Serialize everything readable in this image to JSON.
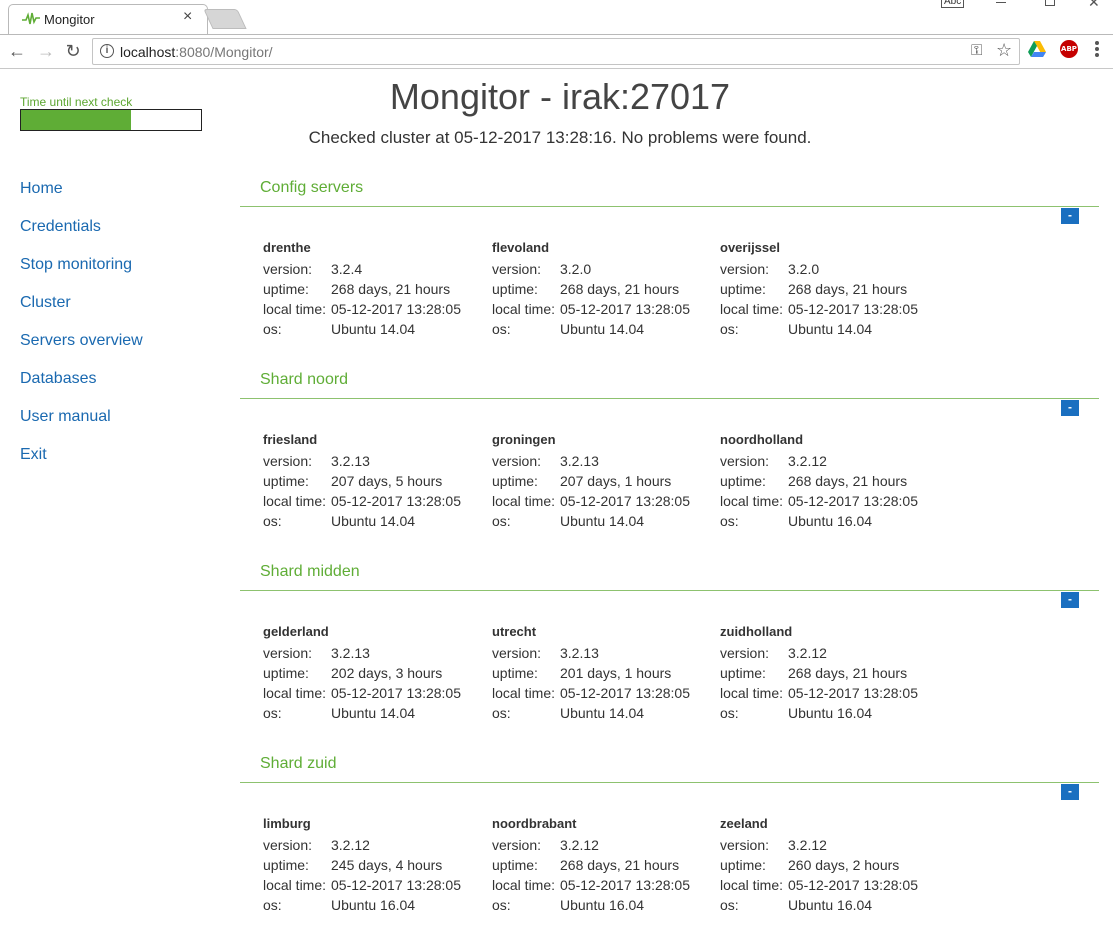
{
  "browser": {
    "tab_title": "Mongitor",
    "url_host": "localhost",
    "url_rest": ":8080/Mongitor/",
    "user_badge": "Abc"
  },
  "timer": {
    "label": "Time until next check",
    "fraction": 0.61
  },
  "sidebar": {
    "items": [
      {
        "label": "Home"
      },
      {
        "label": "Credentials"
      },
      {
        "label": "Stop monitoring"
      },
      {
        "label": "Cluster"
      },
      {
        "label": "Servers overview"
      },
      {
        "label": "Databases"
      },
      {
        "label": "User manual"
      },
      {
        "label": "Exit"
      }
    ]
  },
  "header": {
    "title": "Mongitor - irak:27017",
    "status": "Checked cluster at 05-12-2017 13:28:16. No problems were found."
  },
  "labels": {
    "version": "version:",
    "uptime": "uptime:",
    "local_time": "local time:",
    "os": "os:",
    "collapse": "-"
  },
  "sections": [
    {
      "title": "Config servers",
      "servers": [
        {
          "name": "drenthe",
          "version": "3.2.4",
          "uptime": "268 days, 21 hours",
          "local_time": "05-12-2017 13:28:05",
          "os": "Ubuntu 14.04"
        },
        {
          "name": "flevoland",
          "version": "3.2.0",
          "uptime": "268 days, 21 hours",
          "local_time": "05-12-2017 13:28:05",
          "os": "Ubuntu 14.04"
        },
        {
          "name": "overijssel",
          "version": "3.2.0",
          "uptime": "268 days, 21 hours",
          "local_time": "05-12-2017 13:28:05",
          "os": "Ubuntu 14.04"
        }
      ]
    },
    {
      "title": "Shard noord",
      "servers": [
        {
          "name": "friesland",
          "version": "3.2.13",
          "uptime": "207 days, 5 hours",
          "local_time": "05-12-2017 13:28:05",
          "os": "Ubuntu 14.04"
        },
        {
          "name": "groningen",
          "version": "3.2.13",
          "uptime": "207 days, 1 hours",
          "local_time": "05-12-2017 13:28:05",
          "os": "Ubuntu 14.04"
        },
        {
          "name": "noordholland",
          "version": "3.2.12",
          "uptime": "268 days, 21 hours",
          "local_time": "05-12-2017 13:28:05",
          "os": "Ubuntu 16.04"
        }
      ]
    },
    {
      "title": "Shard midden",
      "servers": [
        {
          "name": "gelderland",
          "version": "3.2.13",
          "uptime": "202 days, 3 hours",
          "local_time": "05-12-2017 13:28:05",
          "os": "Ubuntu 14.04"
        },
        {
          "name": "utrecht",
          "version": "3.2.13",
          "uptime": "201 days, 1 hours",
          "local_time": "05-12-2017 13:28:05",
          "os": "Ubuntu 14.04"
        },
        {
          "name": "zuidholland",
          "version": "3.2.12",
          "uptime": "268 days, 21 hours",
          "local_time": "05-12-2017 13:28:05",
          "os": "Ubuntu 16.04"
        }
      ]
    },
    {
      "title": "Shard zuid",
      "servers": [
        {
          "name": "limburg",
          "version": "3.2.12",
          "uptime": "245 days, 4 hours",
          "local_time": "05-12-2017 13:28:05",
          "os": "Ubuntu 16.04"
        },
        {
          "name": "noordbrabant",
          "version": "3.2.12",
          "uptime": "268 days, 21 hours",
          "local_time": "05-12-2017 13:28:05",
          "os": "Ubuntu 16.04"
        },
        {
          "name": "zeeland",
          "version": "3.2.12",
          "uptime": "260 days, 2 hours",
          "local_time": "05-12-2017 13:28:05",
          "os": "Ubuntu 16.04"
        }
      ]
    }
  ],
  "colors": {
    "accent_green": "#5fad36",
    "link_blue": "#1a69b0",
    "button_blue": "#1a6fc0"
  },
  "icons": [
    "pulse-icon",
    "close-icon",
    "back-icon",
    "forward-icon",
    "reload-icon",
    "info-icon",
    "key-icon",
    "star-icon",
    "drive-icon",
    "adblock-icon",
    "menu-icon"
  ]
}
